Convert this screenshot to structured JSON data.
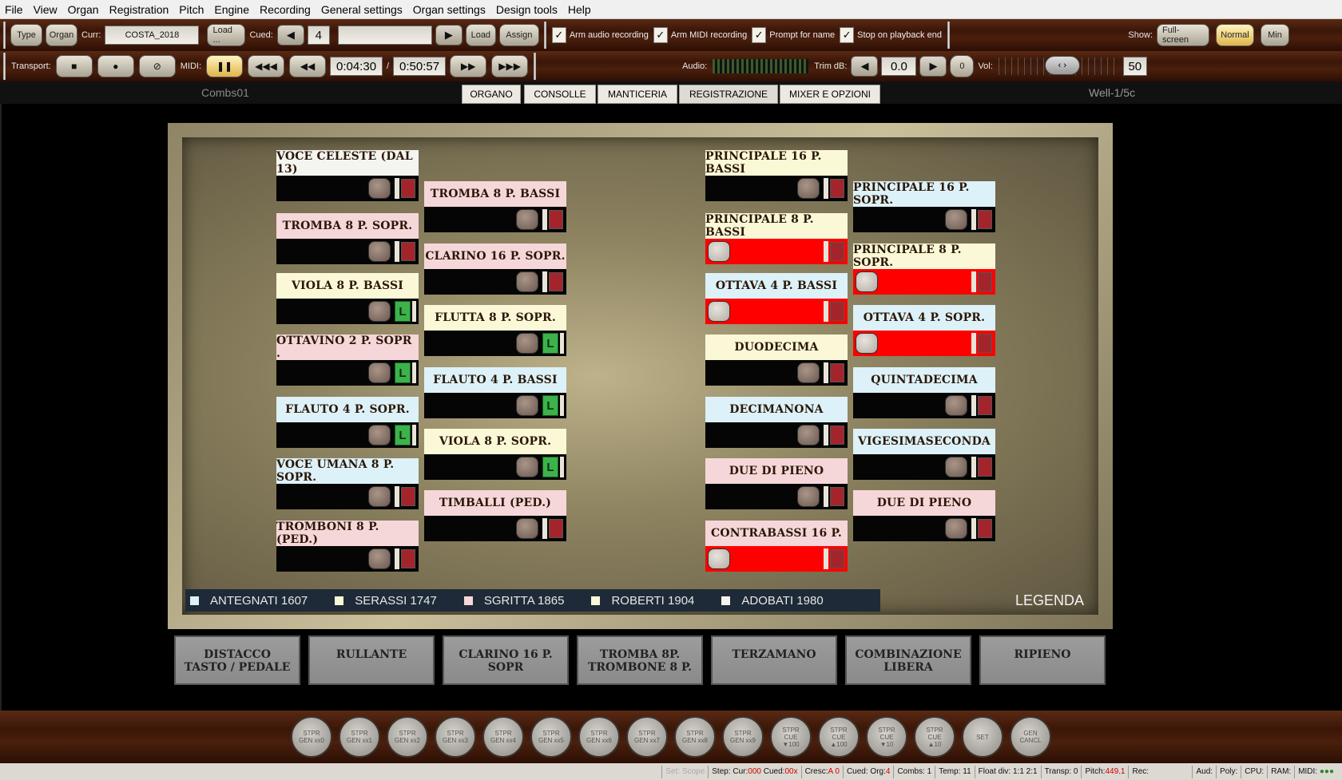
{
  "menu": [
    "File",
    "View",
    "Organ",
    "Registration",
    "Pitch",
    "Engine",
    "Recording",
    "General settings",
    "Organ settings",
    "Design tools",
    "Help"
  ],
  "toolbar1": {
    "type": "Type",
    "organ": "Organ",
    "curr_label": "Curr:",
    "curr_value": "COSTA_2018",
    "load_dots": "Load ...",
    "cued_label": "Cued:",
    "cued_value": "4",
    "load": "Load",
    "assign": "Assign",
    "arm_audio": "Arm audio recording",
    "arm_midi": "Arm MIDI recording",
    "prompt_name": "Prompt for name",
    "stop_playback": "Stop on playback end",
    "show_label": "Show:",
    "fullscreen": "Full-screen",
    "normal": "Normal",
    "min": "Min"
  },
  "toolbar2": {
    "transport_label": "Transport:",
    "midi_label": "MIDI:",
    "time_cur": "0:04:30",
    "time_sep": "/",
    "time_total": "0:50:57",
    "audio_label": "Audio:",
    "trim_label": "Trim dB:",
    "trim_value": "0.0",
    "zero": "0",
    "vol_label": "Vol:",
    "vol_value": "50"
  },
  "tabs": [
    "ORGANO",
    "CONSOLLE",
    "MANTICERIA",
    "REGISTRAZIONE",
    "MIXER E OPZIONI"
  ],
  "active_tab": "REGISTRAZIONE",
  "combination": "Combs01",
  "temperament": "Well-1/5c",
  "stops": [
    {
      "name": "VOCE CELESTE (DAL 13)",
      "color": "white",
      "state": "off",
      "lamp": "none"
    },
    {
      "name": "TROMBA 8 P. SOPR.",
      "color": "pink",
      "state": "off",
      "lamp": "none"
    },
    {
      "name": "VIOLA 8 P. BASSI",
      "color": "yellow",
      "state": "off",
      "lamp": "L"
    },
    {
      "name": "OTTAVINO 2 P. SOPR .",
      "color": "pink",
      "state": "off",
      "lamp": "L"
    },
    {
      "name": "FLAUTO 4 P. SOPR.",
      "color": "blue",
      "state": "off",
      "lamp": "L"
    },
    {
      "name": "VOCE UMANA 8 P. SOPR.",
      "color": "blue",
      "state": "off",
      "lamp": "none"
    },
    {
      "name": "TROMBONI 8 P. (PED.)",
      "color": "pink",
      "state": "off",
      "lamp": "none"
    },
    {
      "name": "TROMBA 8 P. BASSI",
      "color": "pink",
      "state": "off",
      "lamp": "none"
    },
    {
      "name": "CLARINO 16 P. SOPR.",
      "color": "pink",
      "state": "off",
      "lamp": "none"
    },
    {
      "name": "FLUTTA 8 P. SOPR.",
      "color": "yellow",
      "state": "off",
      "lamp": "L"
    },
    {
      "name": "FLAUTO 4 P. BASSI",
      "color": "blue",
      "state": "off",
      "lamp": "L"
    },
    {
      "name": "VIOLA 8 P. SOPR.",
      "color": "yellow",
      "state": "off",
      "lamp": "L"
    },
    {
      "name": "TIMBALLI (PED.)",
      "color": "pink",
      "state": "off",
      "lamp": "none"
    },
    {
      "name": "PRINCIPALE 16 P. BASSI",
      "color": "yellow",
      "state": "off",
      "lamp": "none"
    },
    {
      "name": "PRINCIPALE 8 P. BASSI",
      "color": "yellow",
      "state": "on",
      "lamp": "none"
    },
    {
      "name": "OTTAVA 4 P. BASSI",
      "color": "blue",
      "state": "on",
      "lamp": "none"
    },
    {
      "name": "DUODECIMA",
      "color": "yellow",
      "state": "off",
      "lamp": "none"
    },
    {
      "name": "DECIMANONA",
      "color": "blue",
      "state": "off",
      "lamp": "none"
    },
    {
      "name": "DUE DI PIENO",
      "color": "pink",
      "state": "off",
      "lamp": "none"
    },
    {
      "name": "CONTRABASSI 16 P.",
      "color": "pink",
      "state": "on",
      "lamp": "none"
    },
    {
      "name": "PRINCIPALE 16 P. SOPR.",
      "color": "blue",
      "state": "off",
      "lamp": "none"
    },
    {
      "name": "PRINCIPALE 8 P. SOPR.",
      "color": "yellow",
      "state": "on",
      "lamp": "none"
    },
    {
      "name": "OTTAVA 4 P. SOPR.",
      "color": "blue",
      "state": "on",
      "lamp": "none"
    },
    {
      "name": "QUINTADECIMA",
      "color": "blue",
      "state": "off",
      "lamp": "none"
    },
    {
      "name": "VIGESIMASECONDA",
      "color": "blue",
      "state": "off",
      "lamp": "none"
    },
    {
      "name": "DUE DI PIENO",
      "color": "pink",
      "state": "off",
      "lamp": "none"
    }
  ],
  "legend": [
    {
      "label": "ANTEGNATI 1607",
      "color": "#ddf1f8"
    },
    {
      "label": "SERASSI 1747",
      "color": "#fbf8d8"
    },
    {
      "label": "SGRITTA 1865",
      "color": "#f6d7d9"
    },
    {
      "label": "ROBERTI 1904",
      "color": "#fbf8d8"
    },
    {
      "label": "ADOBATI 1980",
      "color": "#f4f4f0"
    }
  ],
  "legend_title": "LEGENDA",
  "pistons": [
    "DISTACCO\nTASTO / PEDALE",
    "RULLANTE",
    "CLARINO 16 P. SOPR",
    "TROMBA 8P.\nTROMBONE 8 P.",
    "TERZAMANO",
    "COMBINAZIONE\nLIBERA",
    "RIPIENO"
  ],
  "general_buttons": [
    "STPR\nGEN xx0",
    "STPR\nGEN xx1",
    "STPR\nGEN xx2",
    "STPR\nGEN xx3",
    "STPR\nGEN xx4",
    "STPR\nGEN xx5",
    "STPR\nGEN xx6",
    "STPR\nGEN xx7",
    "STPR\nGEN xx8",
    "STPR\nGEN xx9",
    "STPR\nCUE\n▼100",
    "STPR\nCUE\n▲100",
    "STPR\nCUE\n▼10",
    "STPR\nCUE\n▲10",
    "SET",
    "GEN\nCANCL"
  ],
  "status": {
    "set_scope": "Set: Scope",
    "step": "Step: Cur:",
    "step_cur": "000",
    "cued_lbl": "Cued:",
    "cued_val": "00x",
    "cresc": "Cresc:",
    "cresc_val": "A 0",
    "cued_org": "Cued: Org:",
    "cued_org_val": "4",
    "combs": "Combs: 1",
    "temp": "Temp: 11",
    "float": "Float div: 1:1 2:1",
    "transp": "Transp: 0",
    "pitch": "Pitch:",
    "pitch_val": "449.1",
    "rec": "Rec:",
    "aud": "Aud:",
    "poly": "Poly:",
    "cpu": "CPU:",
    "ram": "RAM:",
    "midi": "MIDI:"
  }
}
